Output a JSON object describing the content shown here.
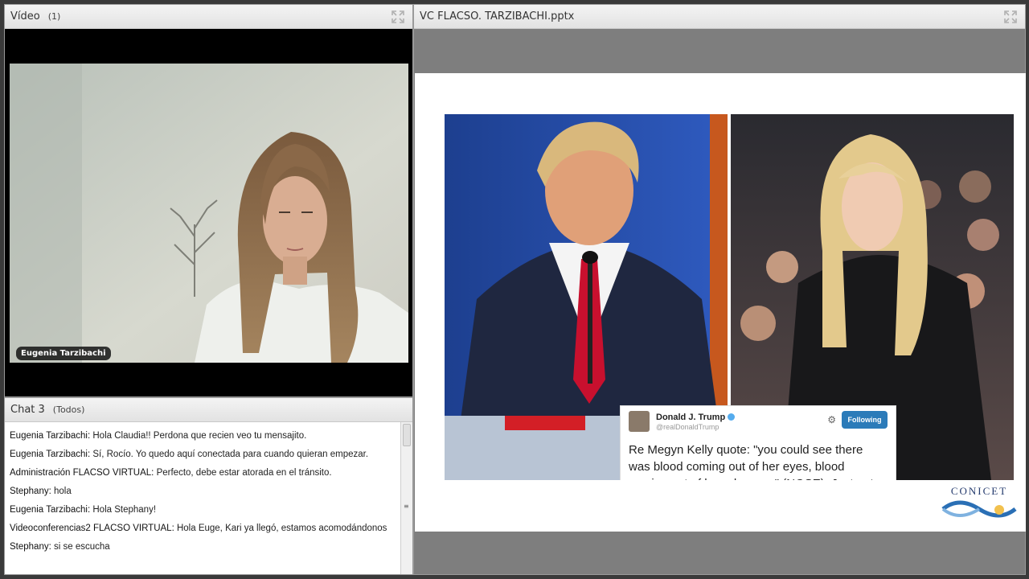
{
  "video_pod": {
    "title": "Vídeo",
    "count": "(1)",
    "participant_name": "Eugenia Tarzibachi"
  },
  "chat_pod": {
    "title": "Chat 3",
    "scope": "(Todos)",
    "messages": [
      {
        "sender": "Eugenia Tarzibachi:",
        "text": "Hola Claudia!! Perdona que recien veo tu mensajito."
      },
      {
        "sender": "Eugenia Tarzibachi:",
        "text": "Sí, Rocío. Yo quedo aquí conectada para cuando quieran empezar."
      },
      {
        "sender": "Administración FLACSO VIRTUAL:",
        "text": "Perfecto, debe estar atorada en el tránsito."
      },
      {
        "sender": "Stephany:",
        "text": "hola"
      },
      {
        "sender": "Eugenia Tarzibachi:",
        "text": "Hola Stephany!"
      },
      {
        "sender": "Videoconferencias2 FLACSO VIRTUAL:",
        "text": "Hola Euge, Kari ya llegó, estamos acomodándonos"
      },
      {
        "sender": "Stephany:",
        "text": "si se escucha"
      }
    ]
  },
  "share_pod": {
    "title": "VC FLACSO. TARZIBACHI.pptx",
    "tweet": {
      "name": "Donald J. Trump",
      "handle": "@realDonaldTrump",
      "follow_label": "Following",
      "text": "Re Megyn Kelly quote: \"you could see there was blood coming out of her eyes, blood coming out of her wherever\" (NOSE). Just got on w/thought"
    },
    "logo_text": "CONICET"
  },
  "colors": {
    "window_bg": "#3a3a3a",
    "share_bg": "#7e7e7e",
    "twitter_blue": "#2b7bb9",
    "trump_tie": "#c8102e"
  },
  "icons": [
    "maximize-icon",
    "gear-icon",
    "verified-icon",
    "scrollbar-grip-icon"
  ]
}
